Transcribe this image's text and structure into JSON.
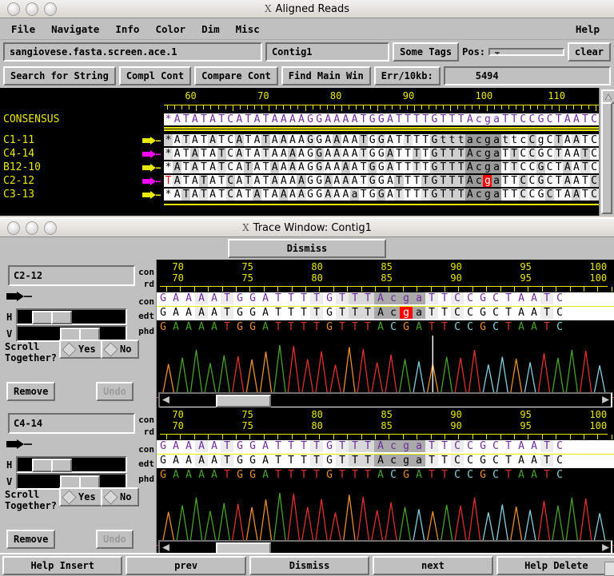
{
  "main_window": {
    "title": "Aligned Reads",
    "menus": [
      "File",
      "Navigate",
      "Info",
      "Color",
      "Dim",
      "Misc"
    ],
    "help_menu": "Help",
    "toolbar": {
      "filename": "sangiovese.fasta.screen.ace.1",
      "contig": "Contig1",
      "tags_button": "Some     Tags",
      "pos_label": "Pos:",
      "pos_value": "",
      "clear_button": "clear",
      "search_button": "Search for String",
      "compl_button": "Compl Cont",
      "compare_button": "Compare Cont",
      "find_button": "Find Main Win",
      "err_button": "Err/10kb:",
      "err_value": "5494"
    },
    "alignment": {
      "ruler_labels": [
        "60",
        "70",
        "80",
        "90",
        "100",
        "110"
      ],
      "consensus_label": "CONSENSUS",
      "consensus_seq": "*ATATATCATATAAAAGGAAAATGGATTTTGTTTAcgaTTCCGCTAATCCTTATGCTCTA",
      "reads": [
        {
          "name": "C1-11",
          "arrow_color": "#e8e800",
          "sequence": "*ATATATCATATAAAAGGAAAATGGATTTTGtttacgattcCgCTAATCCTTATGCTCTa"
        },
        {
          "name": "C4-14",
          "arrow_color": "#ff00ff",
          "sequence": "*ATATATCATATAAAAGGAAAATGGATTTTGTTTAcgaTTCCGCTAATCCTTATGCTCTA"
        },
        {
          "name": "B12-10",
          "arrow_color": "#e8e800",
          "sequence": "*ATATATCATATAAAAGGAAAATGGATTTTGTTTAcgaTTCCGCTAATCCTTATGCTCTA"
        },
        {
          "name": "C2-12",
          "arrow_color": "#ff00ff",
          "sequence": "TATATATCATATAAAAGGAAAATGGATTTTGTTTAcgaTTCCGCTAATCCTTATGCTCTA",
          "first_base_red": true,
          "highlight_index": 36,
          "highlight_color": "#ff0000"
        },
        {
          "name": "C3-13",
          "arrow_color": "#e8e800",
          "sequence": "*ATATATCATATAAAAGGAAAaTGGATTTTGTTTAcgaTTCCGCTAATCCTTATGCTCTA"
        }
      ]
    }
  },
  "trace_window": {
    "title": "Trace Window: Contig1",
    "dismiss_button": "Dismiss",
    "row_tags": {
      "con": "con",
      "rd": "rd",
      "edt": "edt",
      "phd": "phd"
    },
    "controls": {
      "h_label": "H",
      "v_label": "V",
      "scroll_together_label_line1": "Scroll",
      "scroll_together_label_line2": "Together?",
      "yes_label": "Yes",
      "no_label": "No",
      "remove_label": "Remove",
      "undo_label": "Undo"
    },
    "panels": [
      {
        "read_name": "C2-12",
        "ruler_con": [
          "70",
          "75",
          "80",
          "85",
          "90",
          "95",
          "100"
        ],
        "ruler_rd": [
          "70",
          "75",
          "80",
          "85",
          "90",
          "95",
          "100"
        ],
        "con_seq": "GAAAATGGATTTTGTTTAcgaTTCCGCTAATC",
        "edt_seq": "GAAAATGGATTTTGTTTAcgaTTCCGCTAATC",
        "phd_seq": "GAAAATGGATTTTGTTTACGATTCCGCTAATC",
        "highlight_base": "g",
        "highlight_index": 19
      },
      {
        "read_name": "C4-14",
        "ruler_con": [
          "70",
          "75",
          "80",
          "85",
          "90",
          "95",
          "100"
        ],
        "ruler_rd": [
          "70",
          "75",
          "80",
          "85",
          "90",
          "95",
          "100"
        ],
        "con_seq": "GAAAATGGATTTTGTTTAcgaTTCCGCTAATC",
        "edt_seq": "GAAAATGGATTTTGTTTAcgaTTCCGCTAATC",
        "phd_seq": "GAAAATGGATTTTGTTTACGATTCCGCTAATC",
        "highlight_base": null,
        "highlight_index": -1
      }
    ]
  },
  "bottom_bar": {
    "help_insert": "Help Insert",
    "prev": "prev",
    "dismiss": "Dismiss",
    "next": "next",
    "help_delete": "Help Delete"
  },
  "colors": {
    "base_A": "#4aa02c",
    "base_C": "#87cdde",
    "base_G": "#e88f2a",
    "base_T": "#e03030",
    "consensus_text": "#6e2b9e",
    "ruler": "#e8e800",
    "highlight": "#ff0000",
    "window_bg": "#c0c0c0"
  }
}
